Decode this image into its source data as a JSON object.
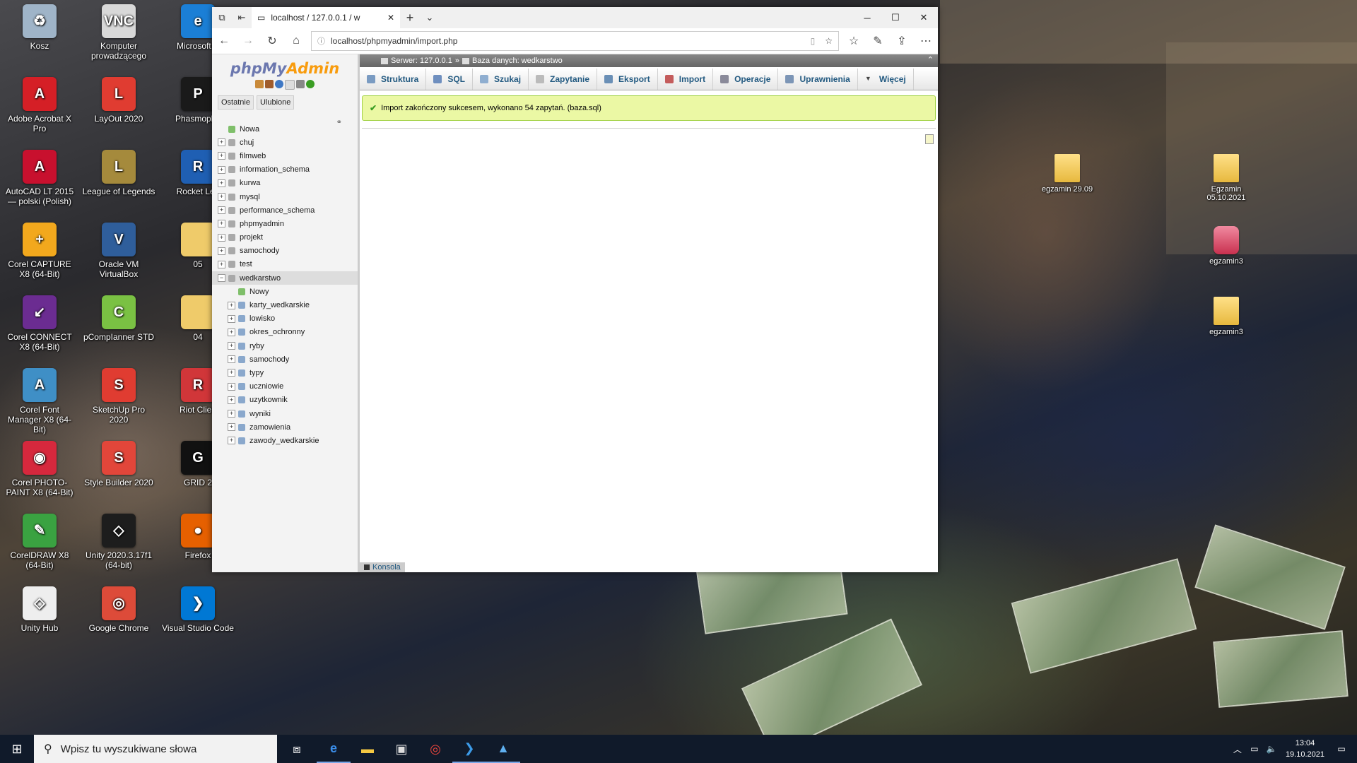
{
  "desktop": {
    "icons_left": [
      {
        "label": "Kosz",
        "icon": "recycle-bin-icon",
        "color": "#9fb4c8",
        "glyph": "♻"
      },
      {
        "label": "Komputer prowadzącego",
        "icon": "vnc-icon",
        "color": "#d8d8d8",
        "glyph": "VNC"
      },
      {
        "label": "Microsoft E",
        "icon": "edge-icon",
        "color": "#1b7fd6",
        "glyph": "e"
      },
      {
        "label": "Adobe Acrobat X Pro",
        "icon": "acrobat-icon",
        "color": "#d51f26",
        "glyph": "A"
      },
      {
        "label": "LayOut 2020",
        "icon": "layout-icon",
        "color": "#e03c31",
        "glyph": "L"
      },
      {
        "label": "Phasmopho",
        "icon": "phasmophobia-icon",
        "color": "#1a1a1a",
        "glyph": "P"
      },
      {
        "label": "AutoCAD LT 2015 — polski (Polish)",
        "icon": "autocad-icon",
        "color": "#c8102e",
        "glyph": "A"
      },
      {
        "label": "League of Legends",
        "icon": "league-icon",
        "color": "#a58a3c",
        "glyph": "L"
      },
      {
        "label": "Rocket Lea",
        "icon": "rocket-league-icon",
        "color": "#1f5fb3",
        "glyph": "R"
      },
      {
        "label": "Corel CAPTURE X8 (64-Bit)",
        "icon": "corel-capture-icon",
        "color": "#f2a81d",
        "glyph": "+"
      },
      {
        "label": "Oracle VM VirtualBox",
        "icon": "virtualbox-icon",
        "color": "#2f5e9b",
        "glyph": "V"
      },
      {
        "label": "05",
        "icon": "folder-icon",
        "color": "#efcb6a",
        "glyph": ""
      },
      {
        "label": "Corel CONNECT X8 (64-Bit)",
        "icon": "corel-connect-icon",
        "color": "#6b2c91",
        "glyph": "↙"
      },
      {
        "label": "pCompIanner STD",
        "icon": "pcomplanner-icon",
        "color": "#7ac143",
        "glyph": "C"
      },
      {
        "label": "04",
        "icon": "folder-icon",
        "color": "#efcb6a",
        "glyph": ""
      },
      {
        "label": "Corel Font Manager X8 (64-Bit)",
        "icon": "corel-font-icon",
        "color": "#3f8fc6",
        "glyph": "A"
      },
      {
        "label": "SketchUp Pro 2020",
        "icon": "sketchup-icon",
        "color": "#e03c31",
        "glyph": "S"
      },
      {
        "label": "Riot Clien",
        "icon": "riot-client-icon",
        "color": "#d13639",
        "glyph": "R"
      },
      {
        "label": "Corel PHOTO-PAINT X8 (64-Bit)",
        "icon": "corel-photopaint-icon",
        "color": "#d6283d",
        "glyph": "◉"
      },
      {
        "label": "Style Builder 2020",
        "icon": "style-builder-icon",
        "color": "#e2463a",
        "glyph": "S"
      },
      {
        "label": "GRID 2",
        "icon": "grid2-icon",
        "color": "#111111",
        "glyph": "G"
      },
      {
        "label": "CorelDRAW X8 (64-Bit)",
        "icon": "coreldraw-icon",
        "color": "#3aa241",
        "glyph": "✎"
      },
      {
        "label": "Unity 2020.3.17f1 (64-bit)",
        "icon": "unity-icon",
        "color": "#1d1d1d",
        "glyph": "◇"
      },
      {
        "label": "Firefox",
        "icon": "firefox-icon",
        "color": "#e66000",
        "glyph": "●"
      },
      {
        "label": "Unity Hub",
        "icon": "unity-hub-icon",
        "color": "#eeeeee",
        "glyph": "◇"
      },
      {
        "label": "Google Chrome",
        "icon": "chrome-icon",
        "color": "#dd4b39",
        "glyph": "◎"
      },
      {
        "label": "Visual Studio Code",
        "icon": "vscode-icon",
        "color": "#0078d4",
        "glyph": "❯"
      }
    ],
    "icons_right": [
      {
        "label": "egzamin 29.09",
        "icon": "folder-icon"
      },
      {
        "label": "Egzamin 05.10.2021",
        "icon": "folder-icon"
      },
      {
        "label": "egzamin3",
        "icon": "database-icon"
      },
      {
        "label": "egzamin3",
        "icon": "folder-icon"
      }
    ]
  },
  "browser": {
    "tab_title": "localhost / 127.0.0.1 / w",
    "url": "localhost/phpmyadmin/import.php",
    "new_tab": "+",
    "tab_list": "⌄"
  },
  "pma": {
    "logo_php": "php",
    "logo_my": "My",
    "logo_admin": "Admin",
    "nav_tabs": [
      "Ostatnie",
      "Ulubione"
    ],
    "databases": [
      {
        "name": "Nowa",
        "type": "new"
      },
      {
        "name": "chuj",
        "type": "db"
      },
      {
        "name": "filmweb",
        "type": "db"
      },
      {
        "name": "information_schema",
        "type": "db"
      },
      {
        "name": "kurwa",
        "type": "db"
      },
      {
        "name": "mysql",
        "type": "db"
      },
      {
        "name": "performance_schema",
        "type": "db"
      },
      {
        "name": "phpmyadmin",
        "type": "db"
      },
      {
        "name": "projekt",
        "type": "db"
      },
      {
        "name": "samochody",
        "type": "db"
      },
      {
        "name": "test",
        "type": "db"
      },
      {
        "name": "wedkarstwo",
        "type": "db-open"
      }
    ],
    "tables": [
      {
        "name": "Nowy",
        "type": "new"
      },
      {
        "name": "karty_wedkarskie",
        "type": "table"
      },
      {
        "name": "lowisko",
        "type": "table"
      },
      {
        "name": "okres_ochronny",
        "type": "table"
      },
      {
        "name": "ryby",
        "type": "table"
      },
      {
        "name": "samochody",
        "type": "table"
      },
      {
        "name": "typy",
        "type": "table"
      },
      {
        "name": "uczniowie",
        "type": "table"
      },
      {
        "name": "uzytkownik",
        "type": "table"
      },
      {
        "name": "wyniki",
        "type": "table"
      },
      {
        "name": "zamowienia",
        "type": "table"
      },
      {
        "name": "zawody_wedkarskie",
        "type": "table"
      }
    ],
    "breadcrumb": {
      "server": "Serwer: 127.0.0.1",
      "separator": "»",
      "database": "Baza danych: wedkarstwo"
    },
    "menu": [
      {
        "label": "Struktura",
        "icon": "structure-icon",
        "color": "#7a9bc2"
      },
      {
        "label": "SQL",
        "icon": "sql-icon",
        "color": "#6f8fbf"
      },
      {
        "label": "Szukaj",
        "icon": "search-icon",
        "color": "#8faed0"
      },
      {
        "label": "Zapytanie",
        "icon": "query-icon",
        "color": "#bbbbbb"
      },
      {
        "label": "Eksport",
        "icon": "export-icon",
        "color": "#6a8fb6"
      },
      {
        "label": "Import",
        "icon": "import-icon",
        "color": "#c45c5c"
      },
      {
        "label": "Operacje",
        "icon": "wrench-icon",
        "color": "#8a8a9a"
      },
      {
        "label": "Uprawnienia",
        "icon": "privileges-icon",
        "color": "#7c95b6"
      },
      {
        "label": "Więcej",
        "icon": "chevron-down-icon",
        "color": "#444444"
      }
    ],
    "success_message": "Import zakończony sukcesem, wykonano 54 zapytań. (baza.sql)",
    "console_label": "Konsola"
  },
  "taskbar": {
    "search_placeholder": "Wpisz tu wyszukiwane słowa",
    "time": "13:04",
    "date": "19.10.2021"
  }
}
